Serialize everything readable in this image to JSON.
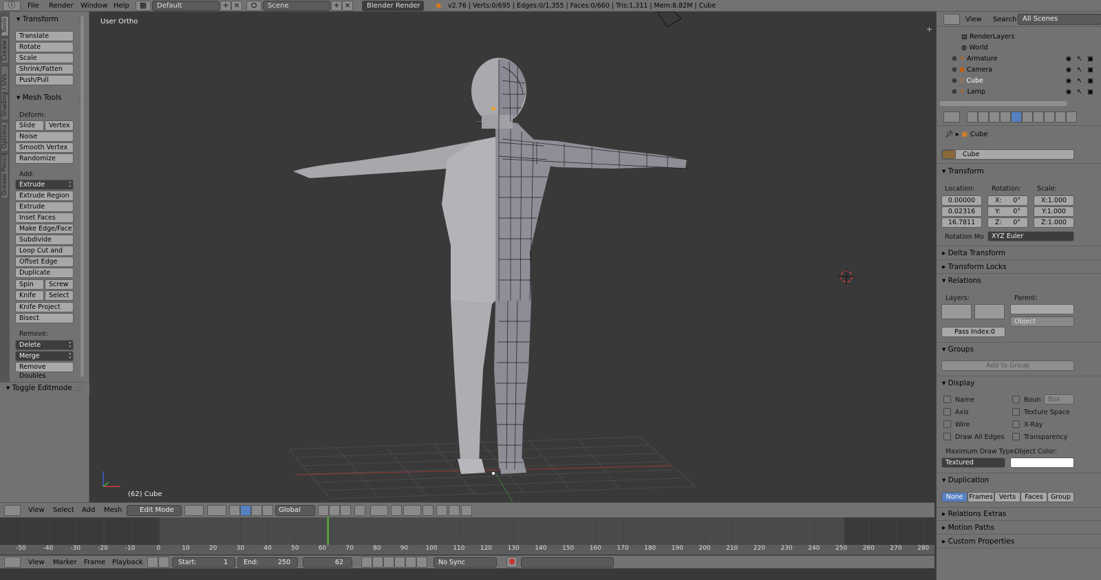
{
  "topbar": {
    "menus": [
      "File",
      "Render",
      "Window",
      "Help"
    ],
    "screen_layout": "Default",
    "scene": "Scene",
    "render_engine": "Blender Render",
    "stats": "v2.76 | Verts:0/695 | Edges:0/1,355 | Faces:0/660 | Tris:1,311 | Mem:8.82M | Cube"
  },
  "vtabs": [
    "Tools",
    "Create",
    "Shading / UVs",
    "Options",
    "Grease Pencil"
  ],
  "toolshelf": {
    "transform_header": "Transform",
    "transform_buttons": [
      "Translate",
      "Rotate",
      "Scale",
      "Shrink/Fatten",
      "Push/Pull"
    ],
    "mesh_tools_header": "Mesh Tools",
    "deform_label": "Deform:",
    "slide_edge": "Slide Ed",
    "vertex": "Vertex",
    "deform_buttons": [
      "Noise",
      "Smooth Vertex",
      "Randomize"
    ],
    "add_label": "Add:",
    "extrude": "Extrude",
    "add_buttons": [
      "Extrude Region",
      "Extrude Individual",
      "Inset Faces",
      "Make Edge/Face",
      "Subdivide",
      "Loop Cut and Slide",
      "Offset Edge Slide",
      "Duplicate"
    ],
    "spin": "Spin",
    "screw": "Screw",
    "knife": "Knife",
    "select": "Select",
    "knife_project": "Knife Project",
    "bisect": "Bisect",
    "remove_label": "Remove:",
    "delete": "Delete",
    "merge": "Merge",
    "remove_doubles": "Remove Doubles",
    "toggle_editmode": "Toggle Editmode"
  },
  "viewport": {
    "view_label": "User Ortho",
    "object_label": "(62) Cube"
  },
  "viewport_header": {
    "menus": [
      "View",
      "Select",
      "Add",
      "Mesh"
    ],
    "mode": "Edit Mode",
    "orientation": "Global"
  },
  "timeline": {
    "ticks": [
      "-50",
      "-40",
      "-30",
      "-20",
      "-10",
      "0",
      "10",
      "20",
      "30",
      "40",
      "50",
      "60",
      "70",
      "80",
      "90",
      "100",
      "110",
      "120",
      "130",
      "140",
      "150",
      "160",
      "170",
      "180",
      "190",
      "200",
      "210",
      "220",
      "230",
      "240",
      "250",
      "260",
      "270",
      "280"
    ],
    "current_frame_fraction": 0.4,
    "footer_menus": [
      "View",
      "Marker",
      "Frame",
      "Playback"
    ],
    "start_label": "Start:",
    "start_value": "1",
    "end_label": "End:",
    "end_value": "250",
    "current_frame": "62",
    "sync": "No Sync"
  },
  "outliner": {
    "menus": [
      "View",
      "Search"
    ],
    "filter": "All Scenes",
    "items": [
      "RenderLayers",
      "World",
      "Armature",
      "Camera",
      "Cube",
      "Lamp"
    ]
  },
  "properties": {
    "breadcrumb": "Cube",
    "object_name": "Cube",
    "transform": {
      "header": "Transform",
      "location_label": "Location:",
      "rotation_label": "Rotation:",
      "scale_label": "Scale:",
      "location": [
        "0.00000",
        "0.02316",
        "16.7811"
      ],
      "rotation": [
        "X:",
        "0°",
        "Y:",
        "0°",
        "Z:",
        "0°"
      ],
      "scale": [
        "X:1.000",
        "Y:1.000",
        "Z:1.000"
      ],
      "rotation_mode_label": "Rotation Mo",
      "rotation_mode": "XYZ Euler"
    },
    "delta_transform": "Delta Transform",
    "transform_locks": "Transform Locks",
    "relations": {
      "header": "Relations",
      "layers_label": "Layers:",
      "parent_label": "Parent:",
      "parent_type": "Object",
      "pass_index_label": "Pass Index:",
      "pass_index": "0"
    },
    "groups": {
      "header": "Groups",
      "add_to_group": "Add to Group"
    },
    "display": {
      "header": "Display",
      "left": [
        "Name",
        "Axis",
        "Wire",
        "Draw All Edges"
      ],
      "right": [
        "Boun",
        "Texture Space",
        "X-Ray",
        "Transparency"
      ],
      "bounds_type": "Box",
      "max_draw_label": "Maximum Draw Type:",
      "object_color_label": "Object Color:",
      "max_draw_type": "Textured"
    },
    "duplication": {
      "header": "Duplication",
      "options": [
        "None",
        "Frames",
        "Verts",
        "Faces",
        "Group"
      ]
    },
    "relations_extras": "Relations Extras",
    "motion_paths": "Motion Paths",
    "custom_properties": "Custom Properties"
  }
}
